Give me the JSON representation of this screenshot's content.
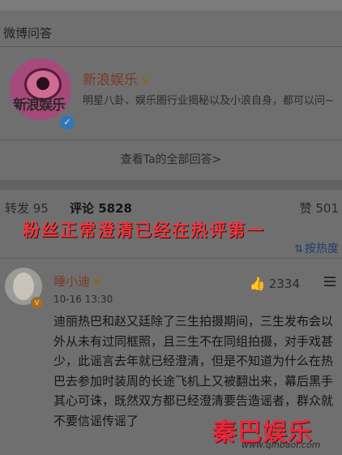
{
  "section": {
    "title": "微博问答"
  },
  "account": {
    "logo_text": "新浪娱乐",
    "name": "新浪娱乐",
    "description": "明星八卦、娱乐圈行业揭秘以及小浪自身，都可以问~"
  },
  "view_all": "查看Ta的全部回答>",
  "stats": {
    "repost": "转发 95",
    "comments": "评论 5828",
    "likes": "赞 501"
  },
  "overlay_caption": "粉丝正常澄清已经在热评第一",
  "sort": {
    "label": "按热度"
  },
  "comment": {
    "author": "睡小迪",
    "time": "10-16 13:30",
    "like_count": "2334",
    "text": "迪丽热巴和赵又廷除了三生拍摄期间，三生发布会以外从未有过同框照，且三生不在同组拍摄，对手戏甚少，此谣言去年就已经澄清，但是不知道为什么在热巴去参加时装周的长途飞机上又被翻出来，幕后黑手其心可诛，既然双方都已经澄清要告造谣者，群众就不要信谣传谣了"
  },
  "watermark": {
    "text": "秦巴娱乐",
    "url": "www.qinbaol.com"
  }
}
